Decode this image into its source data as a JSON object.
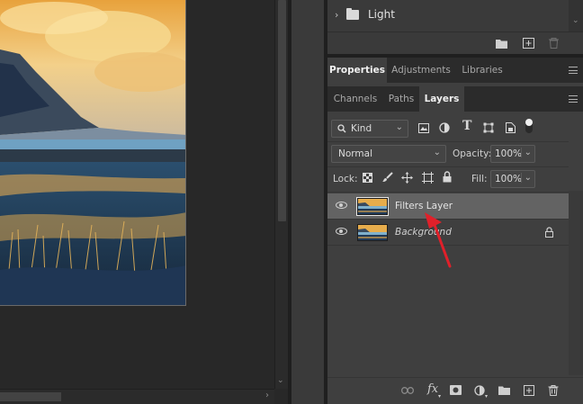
{
  "library_panel": {
    "item_label": "Light"
  },
  "properties_tabs": {
    "tabs": [
      {
        "label": "Properties",
        "active": true
      },
      {
        "label": "Adjustments",
        "active": false
      },
      {
        "label": "Libraries",
        "active": false
      }
    ]
  },
  "layers_tabs": {
    "tabs": [
      {
        "label": "Channels",
        "active": false
      },
      {
        "label": "Paths",
        "active": false
      },
      {
        "label": "Layers",
        "active": true
      }
    ]
  },
  "layers_panel": {
    "filter_kind": "Kind",
    "blend_mode": "Normal",
    "opacity_label": "Opacity:",
    "opacity_value": "100%",
    "lock_label": "Lock:",
    "fill_label": "Fill:",
    "fill_value": "100%",
    "layers": [
      {
        "name": "Filters Layer",
        "selected": true,
        "visible": true,
        "locked": false
      },
      {
        "name": "Background",
        "selected": false,
        "visible": true,
        "locked": true
      }
    ],
    "footer_fx_label": "fx"
  },
  "annotation": {
    "arrow_color": "#e0202a"
  }
}
